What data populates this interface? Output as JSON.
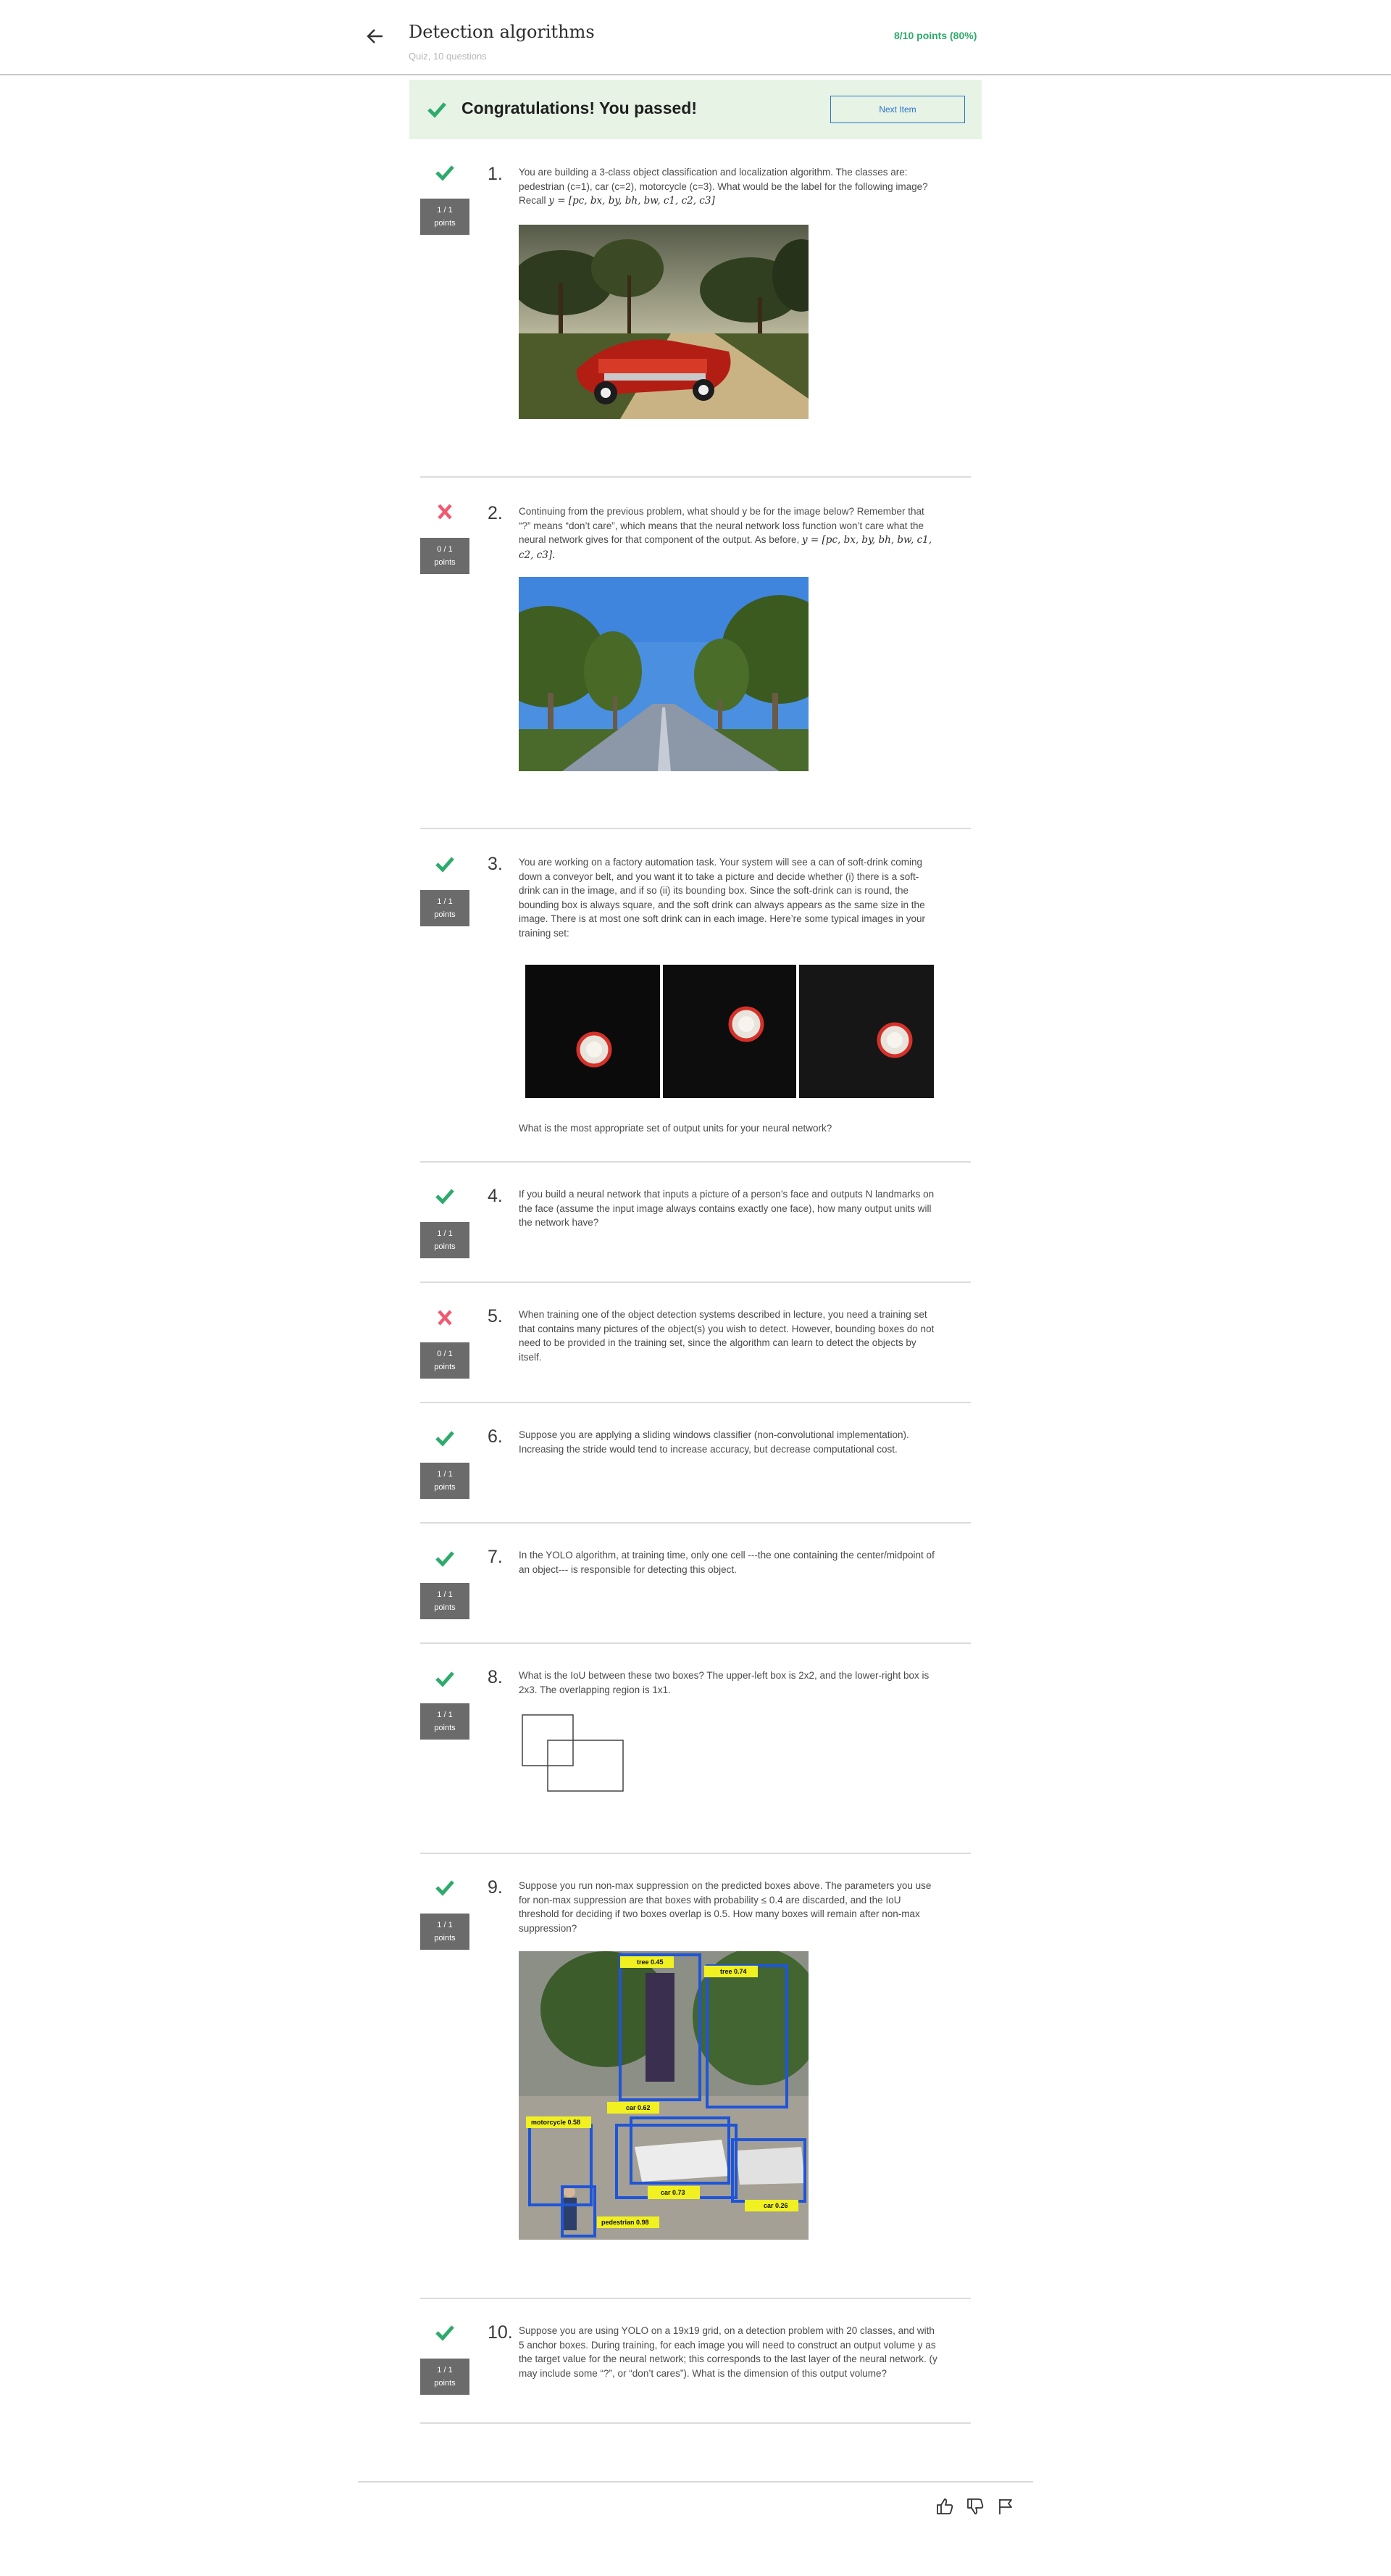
{
  "header": {
    "title": "Detection algorithms",
    "subtitle": "Quiz, 10 questions",
    "score": "8/10 points (80%)"
  },
  "banner": {
    "message": "Congratulations! You passed!",
    "next_label": "Next Item"
  },
  "colors": {
    "correct": "#2eab6c",
    "incorrect": "#ef5a6f",
    "accent": "#2a73cc",
    "banner_bg": "#e6f3e5"
  },
  "questions": [
    {
      "number": "1.",
      "status": "correct",
      "points": "1 / 1",
      "points_label": "points",
      "text": "You are building a 3-class object classification and localization algorithm. The classes are: pedestrian (c=1), car (c=2), motorcycle (c=3). What would be the label for the following image? Recall",
      "formula": "y = [pc, bx, by, bh, bw, c1, c2, c3]"
    },
    {
      "number": "2.",
      "status": "incorrect",
      "points": "0 / 1",
      "points_label": "points",
      "text": "Continuing from the previous problem, what should y be for the image below? Remember that “?” means “don’t care”, which means that the neural network loss function won’t care what the neural network gives for that component of the output. As before,",
      "formula": "y = [pc, bx, by, bh, bw, c1, c2, c3]."
    },
    {
      "number": "3.",
      "status": "correct",
      "points": "1 / 1",
      "points_label": "points",
      "text": "You are working on a factory automation task. Your system will see a can of soft-drink coming down a conveyor belt, and you want it to take a picture and decide whether (i) there is a soft-drink can in the image, and if so (ii) its bounding box. Since the soft-drink can is round, the bounding box is always square, and the soft drink can always appears as the same size in the image. There is at most one soft drink can in each image. Here’re some typical images in your training set:",
      "followup": "What is the most appropriate set of output units for your neural network?"
    },
    {
      "number": "4.",
      "status": "correct",
      "points": "1 / 1",
      "points_label": "points",
      "text": "If you build a neural network that inputs a picture of a person’s face and outputs N landmarks on the face (assume the input image always contains exactly one face), how many output units will the network have?"
    },
    {
      "number": "5.",
      "status": "incorrect",
      "points": "0 / 1",
      "points_label": "points",
      "text": "When training one of the object detection systems described in lecture, you need a training set that contains many pictures of the object(s) you wish to detect. However, bounding boxes do not need to be provided in the training set, since the algorithm can learn to detect the objects by itself."
    },
    {
      "number": "6.",
      "status": "correct",
      "points": "1 / 1",
      "points_label": "points",
      "text": "Suppose you are applying a sliding windows classifier (non-convolutional implementation). Increasing the stride would tend to increase accuracy, but decrease computational cost."
    },
    {
      "number": "7.",
      "status": "correct",
      "points": "1 / 1",
      "points_label": "points",
      "text": "In the YOLO algorithm, at training time, only one cell ---the one containing the center/midpoint of an object--- is responsible for detecting this object."
    },
    {
      "number": "8.",
      "status": "correct",
      "points": "1 / 1",
      "points_label": "points",
      "text": "What is the IoU between these two boxes? The upper-left box is 2x2, and the lower-right box is 2x3. The overlapping region is 1x1."
    },
    {
      "number": "9.",
      "status": "correct",
      "points": "1 / 1",
      "points_label": "points",
      "text": "Suppose you run non-max suppression on the predicted boxes above. The parameters you use for non-max suppression are that boxes with probability ≤ 0.4 are discarded, and the IoU threshold for deciding if two boxes overlap is 0.5. How many boxes will remain after non-max suppression?",
      "detections": [
        "tree 0.45",
        "tree 0.74",
        "car 0.62",
        "motorcycle 0.58",
        "car 0.73",
        "car 0.26",
        "pedestrian 0.98"
      ]
    },
    {
      "number": "10.",
      "status": "correct",
      "points": "1 / 1",
      "points_label": "points",
      "text": "Suppose you are using YOLO on a 19x19 grid, on a detection problem with 20 classes, and with 5 anchor boxes. During training, for each image you will need to construct an output volume y as the target value for the neural network; this corresponds to the last layer of the neural network. (y may include some “?”, or “don’t cares”). What is the dimension of this output volume?"
    }
  ],
  "footer": {
    "icons": [
      "thumbs-up-icon",
      "thumbs-down-icon",
      "flag-icon"
    ]
  }
}
